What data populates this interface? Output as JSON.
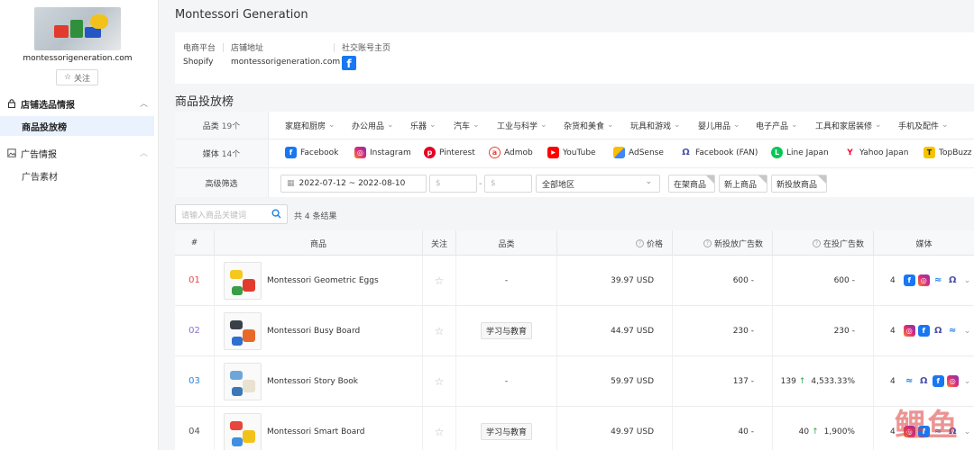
{
  "sidebar": {
    "shop_domain": "montessorigeneration.com",
    "follow_label": "关注",
    "groups": [
      {
        "label": "店铺选品情报",
        "items": [
          "商品投放榜"
        ]
      },
      {
        "label": "广告情报",
        "items": [
          "广告素材"
        ]
      }
    ]
  },
  "header": {
    "title": "Montessori Generation"
  },
  "info": {
    "platform_label": "电商平台",
    "platform_value": "Shopify",
    "store_label": "店铺地址",
    "store_value": "montessorigeneration.com",
    "social_label": "社交账号主页",
    "social_icon": "facebook-icon"
  },
  "section_title": "商品投放榜",
  "filters": {
    "category_label": "品类",
    "category_count": "19个",
    "categories": [
      "家庭和厨房",
      "办公用品",
      "乐器",
      "汽车",
      "工业与科学",
      "杂货和美食",
      "玩具和游戏",
      "婴儿用品",
      "电子产品",
      "工具和家居装修",
      "手机及配件"
    ],
    "media_label": "媒体",
    "media_count": "14个",
    "media": [
      {
        "name": "Facebook",
        "icon": "facebook-icon",
        "color": "#1877f2",
        "glyph": "f"
      },
      {
        "name": "Instagram",
        "icon": "instagram-icon",
        "color": "#d62976",
        "glyph": "◎"
      },
      {
        "name": "Pinterest",
        "icon": "pinterest-icon",
        "color": "#e60023",
        "glyph": "p"
      },
      {
        "name": "Admob",
        "icon": "admob-icon",
        "color": "#ea4335",
        "glyph": "a"
      },
      {
        "name": "YouTube",
        "icon": "youtube-icon",
        "color": "#ff0000",
        "glyph": "▶"
      },
      {
        "name": "AdSense",
        "icon": "adsense-icon",
        "color": "#fbbc04",
        "glyph": "◆"
      },
      {
        "name": "Facebook (FAN)",
        "icon": "facebook-fan-icon",
        "color": "#4b4fa6",
        "glyph": "Ω"
      },
      {
        "name": "Line Japan",
        "icon": "line-icon",
        "color": "#06c755",
        "glyph": "L"
      },
      {
        "name": "Yahoo Japan",
        "icon": "yahoo-icon",
        "color": "#ff0033",
        "glyph": "Y"
      },
      {
        "name": "TopBuzz J",
        "icon": "topbuzz-icon",
        "color": "#f5c400",
        "glyph": "T"
      }
    ],
    "advanced_label": "高级筛选",
    "date_range": "2022-07-12 ~ 2022-08-10",
    "price_min_placeholder": "$",
    "price_max_placeholder": "$",
    "region_value": "全部地区",
    "tags": [
      "在架商品",
      "新上商品",
      "新投放商品"
    ]
  },
  "search": {
    "placeholder": "请输入商品关键词",
    "result_text": "共 4 条结果"
  },
  "table": {
    "columns": [
      "#",
      "商品",
      "关注",
      "品类",
      "价格",
      "新投放广告数",
      "在投广告数",
      "媒体"
    ],
    "rows": [
      {
        "rank": "01",
        "rank_color": "#e8454b",
        "name": "Montessori Geometric Eggs",
        "category": "-",
        "price": "39.97 USD",
        "new_ads": "600 -",
        "active_ads": "600",
        "active_change": "-",
        "media_count": "4",
        "media": [
          "facebook-icon",
          "instagram-icon",
          "messenger-icon",
          "audience-network-icon"
        ]
      },
      {
        "rank": "02",
        "rank_color": "#8c6fd3",
        "name": "Montessori Busy Board",
        "category": "学习与教育",
        "price": "44.97 USD",
        "new_ads": "230 -",
        "active_ads": "230",
        "active_change": "-",
        "media_count": "4",
        "media": [
          "instagram-icon",
          "facebook-icon",
          "audience-network-icon",
          "messenger-icon"
        ]
      },
      {
        "rank": "03",
        "rank_color": "#2d86d9",
        "name": "Montessori Story Book",
        "category": "-",
        "price": "59.97 USD",
        "new_ads": "137 -",
        "active_ads": "139",
        "active_change": "4,533.33%",
        "media_count": "4",
        "media": [
          "messenger-icon",
          "audience-network-icon",
          "facebook-icon",
          "instagram-icon"
        ]
      },
      {
        "rank": "04",
        "rank_color": "#555555",
        "name": "Montessori Smart Board",
        "category": "学习与教育",
        "price": "49.97 USD",
        "new_ads": "40 -",
        "active_ads": "40",
        "active_change": "1,900%",
        "media_count": "4",
        "media": [
          "instagram-icon",
          "facebook-icon",
          "messenger-icon",
          "audience-network-icon"
        ]
      }
    ]
  },
  "watermark": "鲤鱼"
}
